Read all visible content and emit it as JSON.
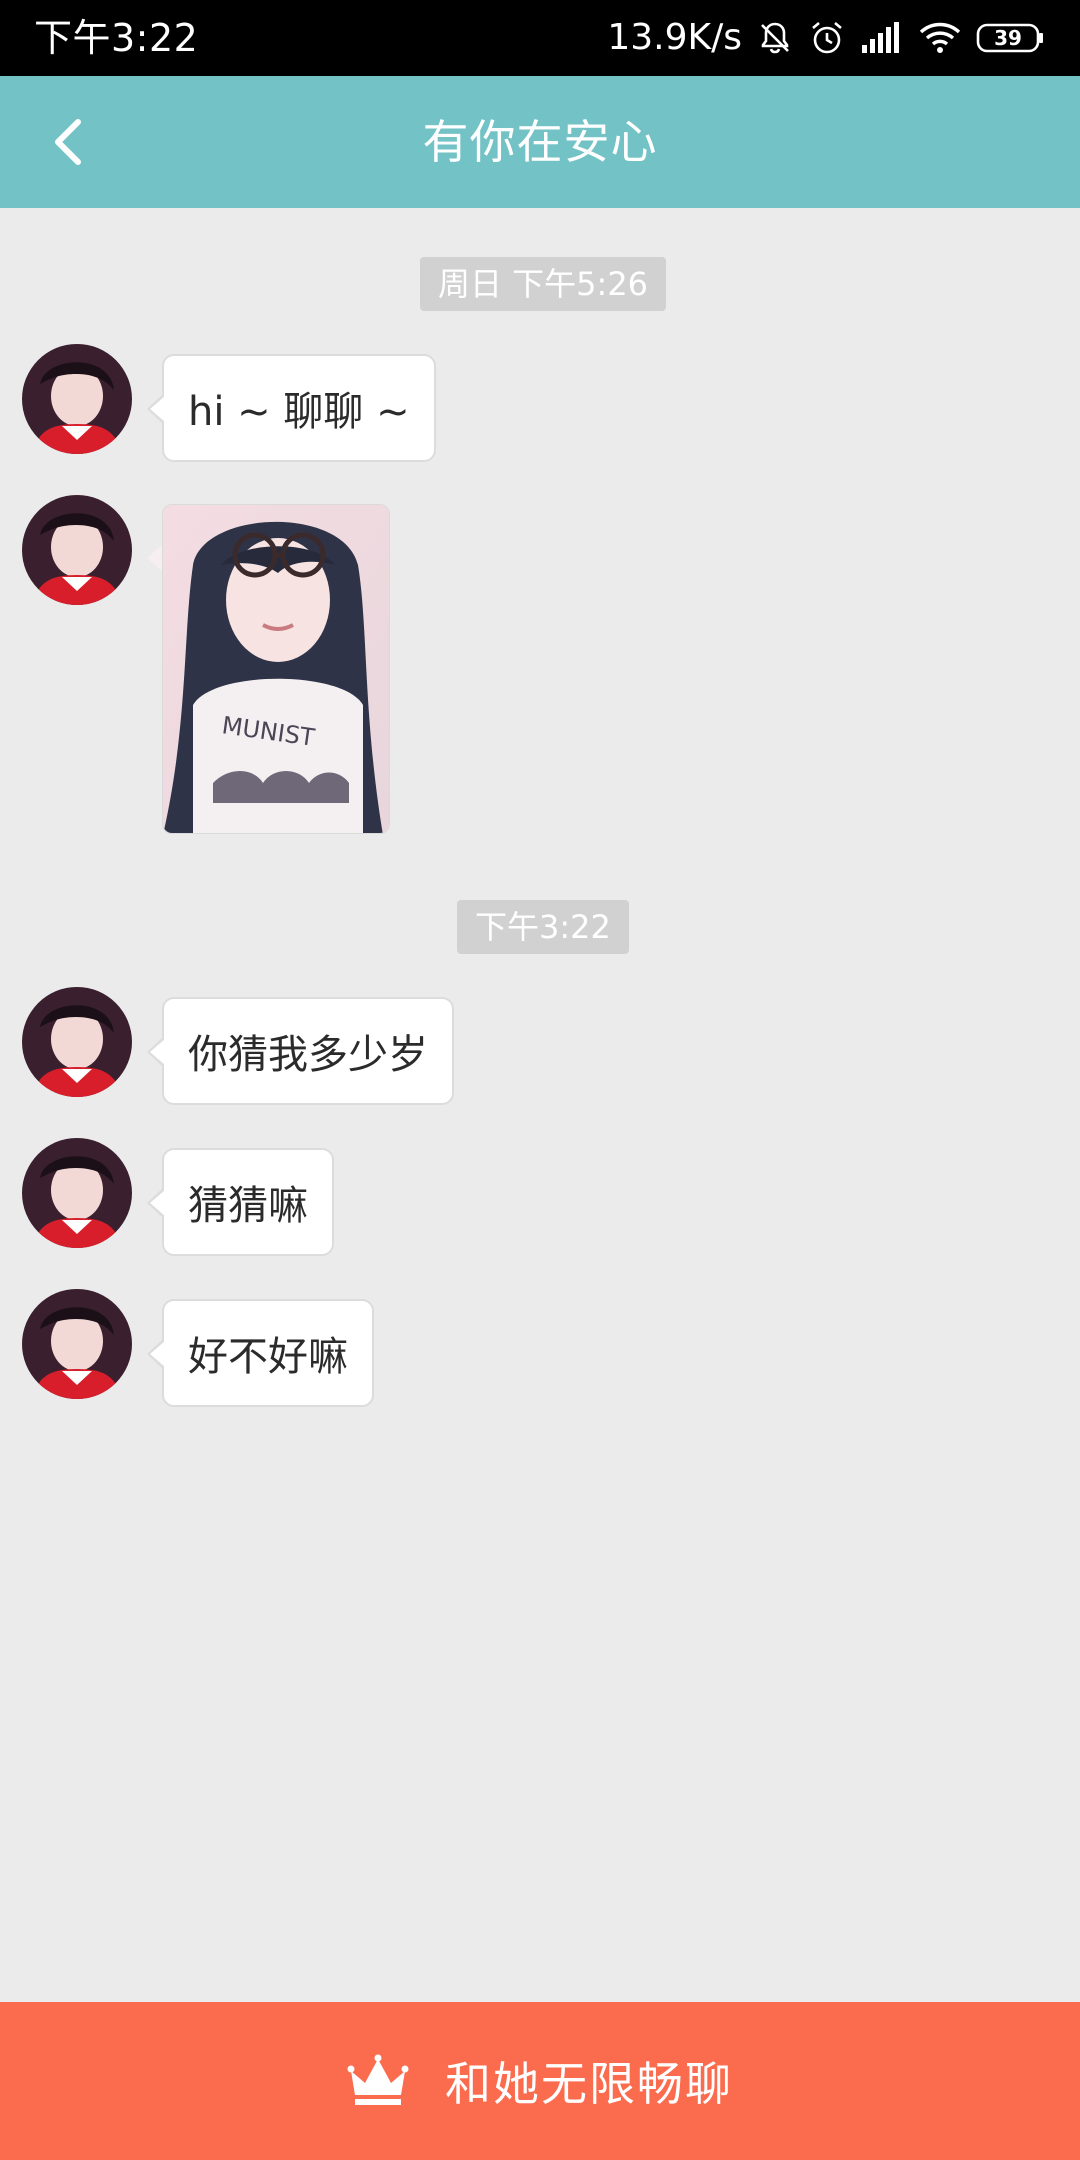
{
  "status_bar": {
    "time": "下午3:22",
    "network_speed": "13.9K/s",
    "battery_level": "39",
    "icons": [
      "bell-muted-icon",
      "alarm-icon",
      "signal-icon",
      "wifi-icon",
      "battery-icon"
    ]
  },
  "header": {
    "title": "有你在安心",
    "back_icon": "chevron-left-icon",
    "background": "#72c2c6"
  },
  "chat": {
    "timestamps": [
      "周日 下午5:26",
      "下午3:22"
    ],
    "messages": [
      {
        "type": "text",
        "text": "hi ~ 聊聊 ~"
      },
      {
        "type": "image",
        "content": "selfie-photo"
      },
      {
        "type": "text",
        "text": "你猜我多少岁"
      },
      {
        "type": "text",
        "text": "猜猜嘛"
      },
      {
        "type": "text",
        "text": "好不好嘛"
      }
    ]
  },
  "bottom_bar": {
    "label": "和她无限畅聊",
    "icon": "crown-icon",
    "background": "#fb6b4e"
  }
}
